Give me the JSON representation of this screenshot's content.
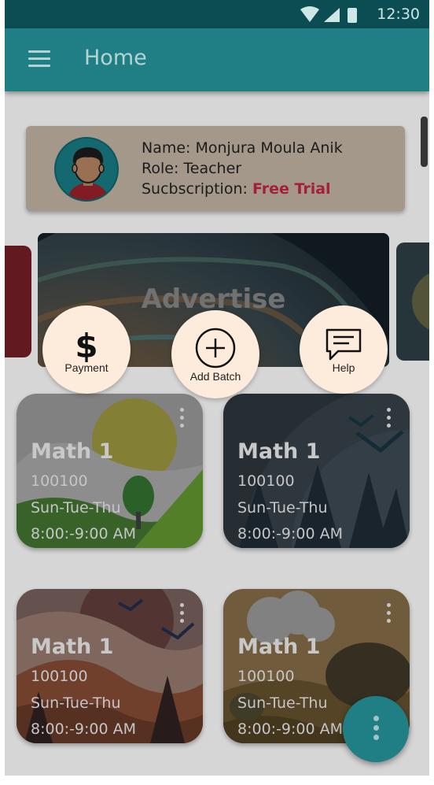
{
  "status_bar": {
    "time": "12:30"
  },
  "app_bar": {
    "title": "Home"
  },
  "profile": {
    "name_line": "Name: Monjura Moula Anik",
    "role_line": "Role: Teacher",
    "subscription_label": "Sucbscription: ",
    "subscription_value": "Free Trial"
  },
  "advertise": {
    "label": "Advertise"
  },
  "quick_actions": [
    {
      "label": "Payment",
      "icon": "dollar-icon"
    },
    {
      "label": "Add Batch",
      "icon": "plus-circle-icon"
    },
    {
      "label": "Help",
      "icon": "chat-icon"
    }
  ],
  "batches": [
    {
      "title": "Math 1",
      "code": "100100",
      "days": "Sun-Tue-Thu",
      "time": "8:00:-9:00 AM"
    },
    {
      "title": "Math 1",
      "code": "100100",
      "days": "Sun-Tue-Thu",
      "time": "8:00:-9:00 AM"
    },
    {
      "title": "Math 1",
      "code": "100100",
      "days": "Sun-Tue-Thu",
      "time": "8:00:-9:00 AM"
    },
    {
      "title": "Math 1",
      "code": "100100",
      "days": "Sun-Tue-Thu",
      "time": "8:00:-9:00 AM"
    }
  ],
  "colors": {
    "app_bar": "#1f7f84",
    "status_bar": "#0b4d52",
    "accent_red": "#b2233e",
    "action_bg": "#fdebdc"
  }
}
